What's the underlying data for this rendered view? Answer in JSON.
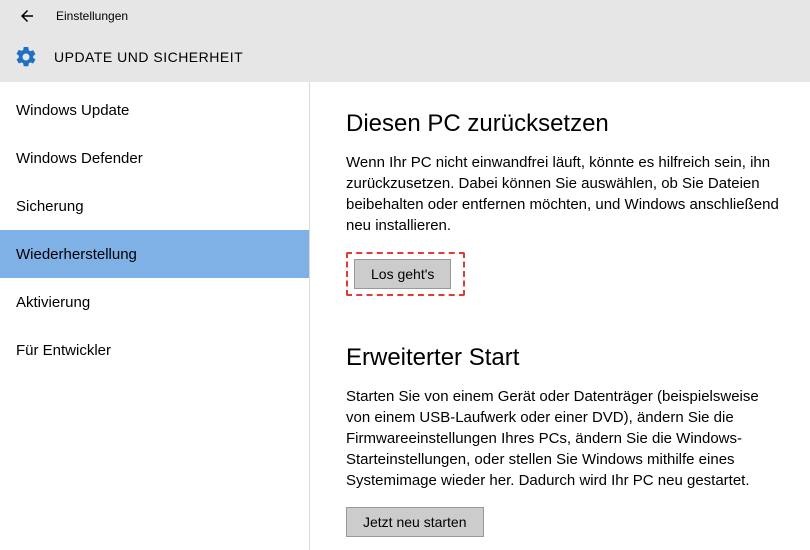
{
  "window": {
    "title": "Einstellungen"
  },
  "header": {
    "title": "UPDATE UND SICHERHEIT"
  },
  "sidebar": {
    "items": [
      {
        "label": "Windows Update",
        "selected": false
      },
      {
        "label": "Windows Defender",
        "selected": false
      },
      {
        "label": "Sicherung",
        "selected": false
      },
      {
        "label": "Wiederherstellung",
        "selected": true
      },
      {
        "label": "Aktivierung",
        "selected": false
      },
      {
        "label": "Für Entwickler",
        "selected": false
      }
    ]
  },
  "content": {
    "reset": {
      "title": "Diesen PC zurücksetzen",
      "desc": "Wenn Ihr PC nicht einwandfrei läuft, könnte es hilfreich sein, ihn zurückzusetzen. Dabei können Sie auswählen, ob Sie Dateien beibehalten oder entfernen möchten, und Windows anschließend neu installieren.",
      "button": "Los geht's"
    },
    "advanced": {
      "title": "Erweiterter Start",
      "desc": "Starten Sie von einem Gerät oder Datenträger (beispielsweise von einem USB-Laufwerk oder einer DVD), ändern Sie die Firmwareeinstellungen Ihres PCs, ändern Sie die Windows-Starteinstellungen, oder stellen Sie Windows mithilfe eines Systemimage wieder her. Dadurch wird Ihr PC neu gestartet.",
      "button": "Jetzt neu starten"
    }
  }
}
